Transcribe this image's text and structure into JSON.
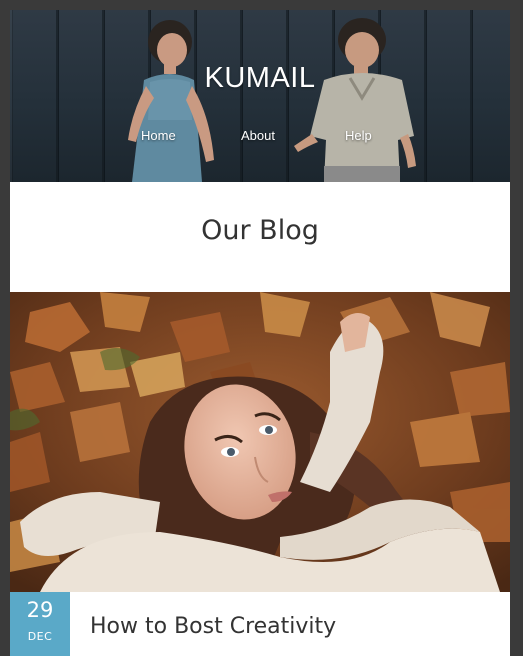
{
  "site": {
    "brand": "KUMAIL"
  },
  "nav": {
    "items": [
      {
        "label": "Home"
      },
      {
        "label": "About"
      },
      {
        "label": "Help"
      }
    ]
  },
  "blog": {
    "title": "Our Blog"
  },
  "post": {
    "date_day": "29",
    "date_month": "DEC",
    "title": "How to Bost Creativity"
  },
  "colors": {
    "date_badge": "#5aa9c8",
    "text": "#333333",
    "frame_bg": "#3a3a3a"
  }
}
